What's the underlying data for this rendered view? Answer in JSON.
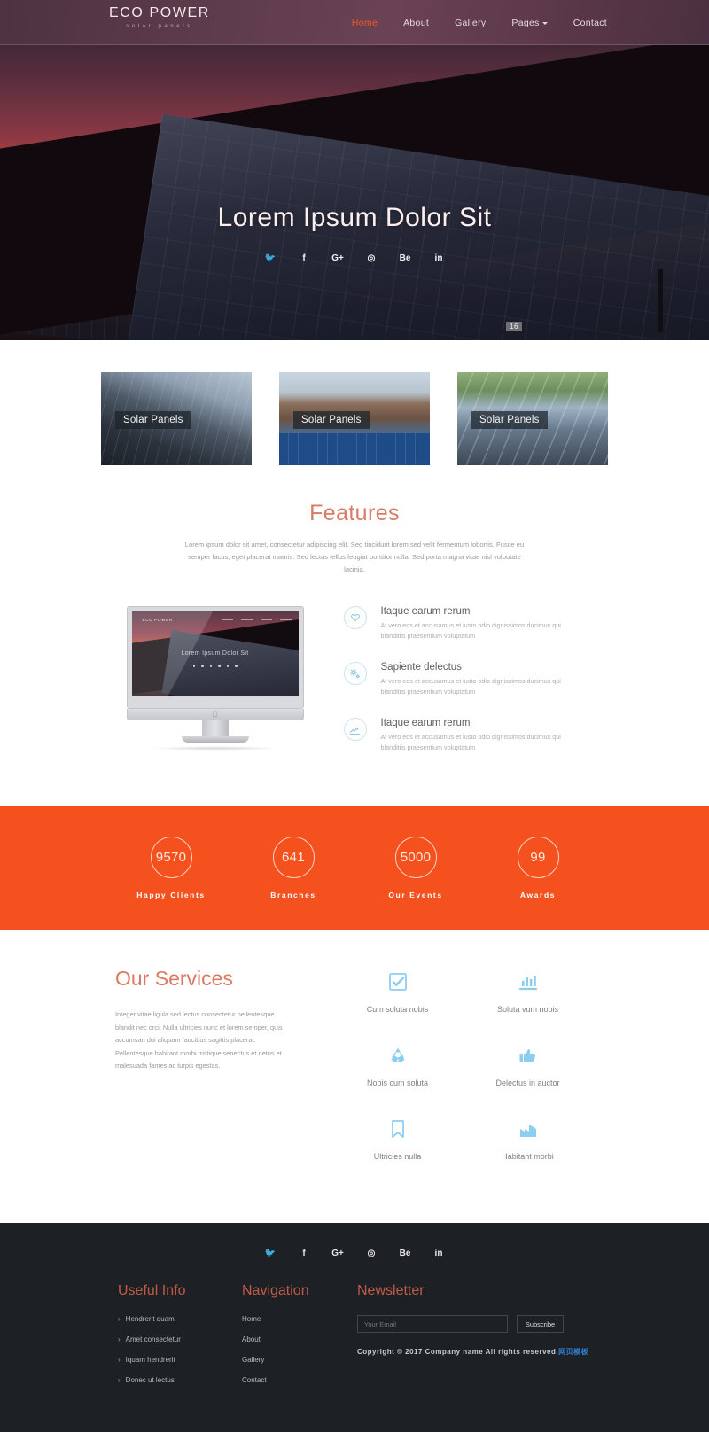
{
  "header": {
    "logo_main": "ECO POWER",
    "logo_sub": "solar panels",
    "nav": [
      {
        "label": "Home",
        "active": true,
        "caret": false
      },
      {
        "label": "About",
        "active": false,
        "caret": false
      },
      {
        "label": "Gallery",
        "active": false,
        "caret": false
      },
      {
        "label": "Pages",
        "active": false,
        "caret": true
      },
      {
        "label": "Contact",
        "active": false,
        "caret": false
      }
    ]
  },
  "hero": {
    "title": "Lorem Ipsum Dolor Sit",
    "badge": "16",
    "social": [
      {
        "name": "twitter-icon",
        "glyph": "🐦"
      },
      {
        "name": "facebook-icon",
        "glyph": "f"
      },
      {
        "name": "google-plus-icon",
        "glyph": "G+"
      },
      {
        "name": "dribbble-icon",
        "glyph": "◎"
      },
      {
        "name": "behance-icon",
        "glyph": "Be"
      },
      {
        "name": "linkedin-icon",
        "glyph": "in"
      }
    ]
  },
  "cards": [
    {
      "label": "Solar Panels"
    },
    {
      "label": "Solar Panels"
    },
    {
      "label": "Solar Panels"
    }
  ],
  "features": {
    "title": "Features",
    "subtitle": "Lorem ipsum dolor sit amet, consectetur adipiscing elit. Sed tincidunt lorem sed velit fermentum lobortis. Fusce eu semper lacus, eget placerat mauris. Sed lectus tellus feugiat porttitor nulla. Sed porta magna vitae nisl vulputate lacinia.",
    "mockup": {
      "logo": "ECO POWER",
      "title": "Lorem Ipsum Dolor Sit"
    },
    "items": [
      {
        "icon": "heart-icon",
        "title": "Itaque earum rerum",
        "desc": "At vero eos et accusamus et iusto odio dignissimos ducimus qui blanditiis praesentium voluptatum"
      },
      {
        "icon": "cogs-icon",
        "title": "Sapiente delectus",
        "desc": "At vero eos et accusamus et iusto odio dignissimos ducimus qui blanditiis praesentium voluptatum"
      },
      {
        "icon": "chart-line-icon",
        "title": "Itaque earum rerum",
        "desc": "At vero eos et accusamus et iusto odio dignissimos ducimus qui blanditiis praesentium voluptatum"
      }
    ]
  },
  "stats": {
    "background_color": "#f4511e",
    "items": [
      {
        "value": "9570",
        "label": "Happy Clients"
      },
      {
        "value": "641",
        "label": "Branches"
      },
      {
        "value": "5000",
        "label": "Our Events"
      },
      {
        "value": "99",
        "label": "Awards"
      }
    ]
  },
  "services": {
    "title": "Our Services",
    "description": "Integer vitae ligula sed lectus consectetur pellentesque blandit nec orci. Nulla ultricies nunc et lorem semper, quis accumsan dui aliquam faucibus sagittis placerat. Pellentesque habitant morbi tristique senectus et netus et malesuada fames ac turpis egestas.",
    "items": [
      {
        "icon": "check-square-icon",
        "label": "Cum soluta nobis"
      },
      {
        "icon": "bar-chart-icon",
        "label": "Soluta vum nobis"
      },
      {
        "icon": "recycle-icon",
        "label": "Nobis cum soluta"
      },
      {
        "icon": "thumbs-up-icon",
        "label": "Delectus in auctor"
      },
      {
        "icon": "bookmark-icon",
        "label": "Ultricies nulla"
      },
      {
        "icon": "factory-icon",
        "label": "Habitant morbi"
      }
    ]
  },
  "footer": {
    "social": [
      {
        "name": "twitter-icon",
        "glyph": "🐦"
      },
      {
        "name": "facebook-icon",
        "glyph": "f"
      },
      {
        "name": "google-plus-icon",
        "glyph": "G+"
      },
      {
        "name": "dribbble-icon",
        "glyph": "◎"
      },
      {
        "name": "behance-icon",
        "glyph": "Be"
      },
      {
        "name": "linkedin-icon",
        "glyph": "in"
      }
    ],
    "useful": {
      "title": "Useful Info",
      "items": [
        "Hendrerit quam",
        "Amet consectetur",
        "Iquam hendrerit",
        "Donec ut lectus"
      ]
    },
    "navigation": {
      "title": "Navigation",
      "items": [
        "Home",
        "About",
        "Gallery",
        "Contact"
      ]
    },
    "newsletter": {
      "title": "Newsletter",
      "placeholder": "Your Email",
      "value": "",
      "button": "Subscribe",
      "copyright": "Copyright © 2017 Company name All rights reserved.",
      "copyright_link": "网页模板"
    }
  },
  "colors": {
    "accent_orange": "#f4511e",
    "salmon": "#d97b63",
    "icon_blue": "#8ccef0",
    "footer_bg": "#1d2125",
    "footer_heading": "#c25a48"
  }
}
